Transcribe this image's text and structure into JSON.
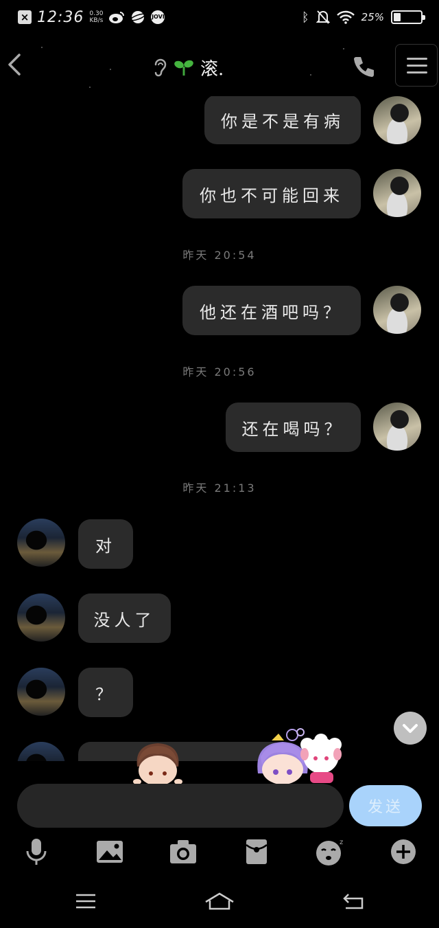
{
  "status_bar": {
    "time": "12:36",
    "net_speed_value": "0.30",
    "net_speed_unit": "KB/s",
    "jovi_label": "JOVI",
    "battery_percent": "25%",
    "battery_level": 0.25,
    "icons": [
      "close-notification-icon",
      "weibo-icon",
      "planet-app-icon",
      "jovi-icon",
      "bluetooth-icon",
      "mute-icon",
      "wifi-icon",
      "battery-icon"
    ]
  },
  "header": {
    "contact_name": "滚.",
    "icons": [
      "back-arrow-icon",
      "ear-icon",
      "sprout-icon",
      "phone-icon",
      "menu-icon"
    ]
  },
  "messages": [
    {
      "side": "out",
      "text": "你是不是有病"
    },
    {
      "side": "out",
      "text": "你也不可能回来"
    },
    {
      "side": "out",
      "text": "他还在酒吧吗？"
    },
    {
      "side": "out",
      "text": "还在喝吗？"
    },
    {
      "side": "in",
      "text": "对"
    },
    {
      "side": "in",
      "text": "没人了"
    },
    {
      "side": "in",
      "text": "？"
    }
  ],
  "timestamps": [
    "昨天 20:54",
    "昨天 20:56",
    "昨天 21:13"
  ],
  "input": {
    "value": "",
    "placeholder": "",
    "send_label": "发送",
    "send_color": "#a9d3fb"
  },
  "toolbar": {
    "icons": [
      "microphone-icon",
      "image-icon",
      "camera-icon",
      "red-packet-icon",
      "sticker-emoji-icon",
      "plus-icon"
    ]
  },
  "nav_bar": {
    "icons": [
      "recents-menu-icon",
      "home-icon",
      "back-icon"
    ]
  },
  "colors": {
    "background": "#000000",
    "bubble": "#2b2b2b",
    "accent": "#a9d3fb"
  }
}
